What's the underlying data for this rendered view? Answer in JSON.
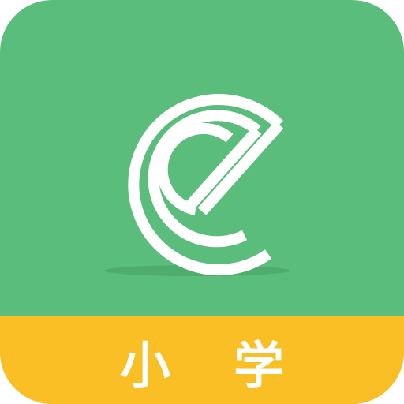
{
  "app_icon": {
    "logo_icon": "letter-e-logo-icon",
    "banner_label": "小学",
    "colors": {
      "background": "#5bbd7b",
      "banner": "#f9bf24",
      "foreground": "#ffffff"
    }
  }
}
